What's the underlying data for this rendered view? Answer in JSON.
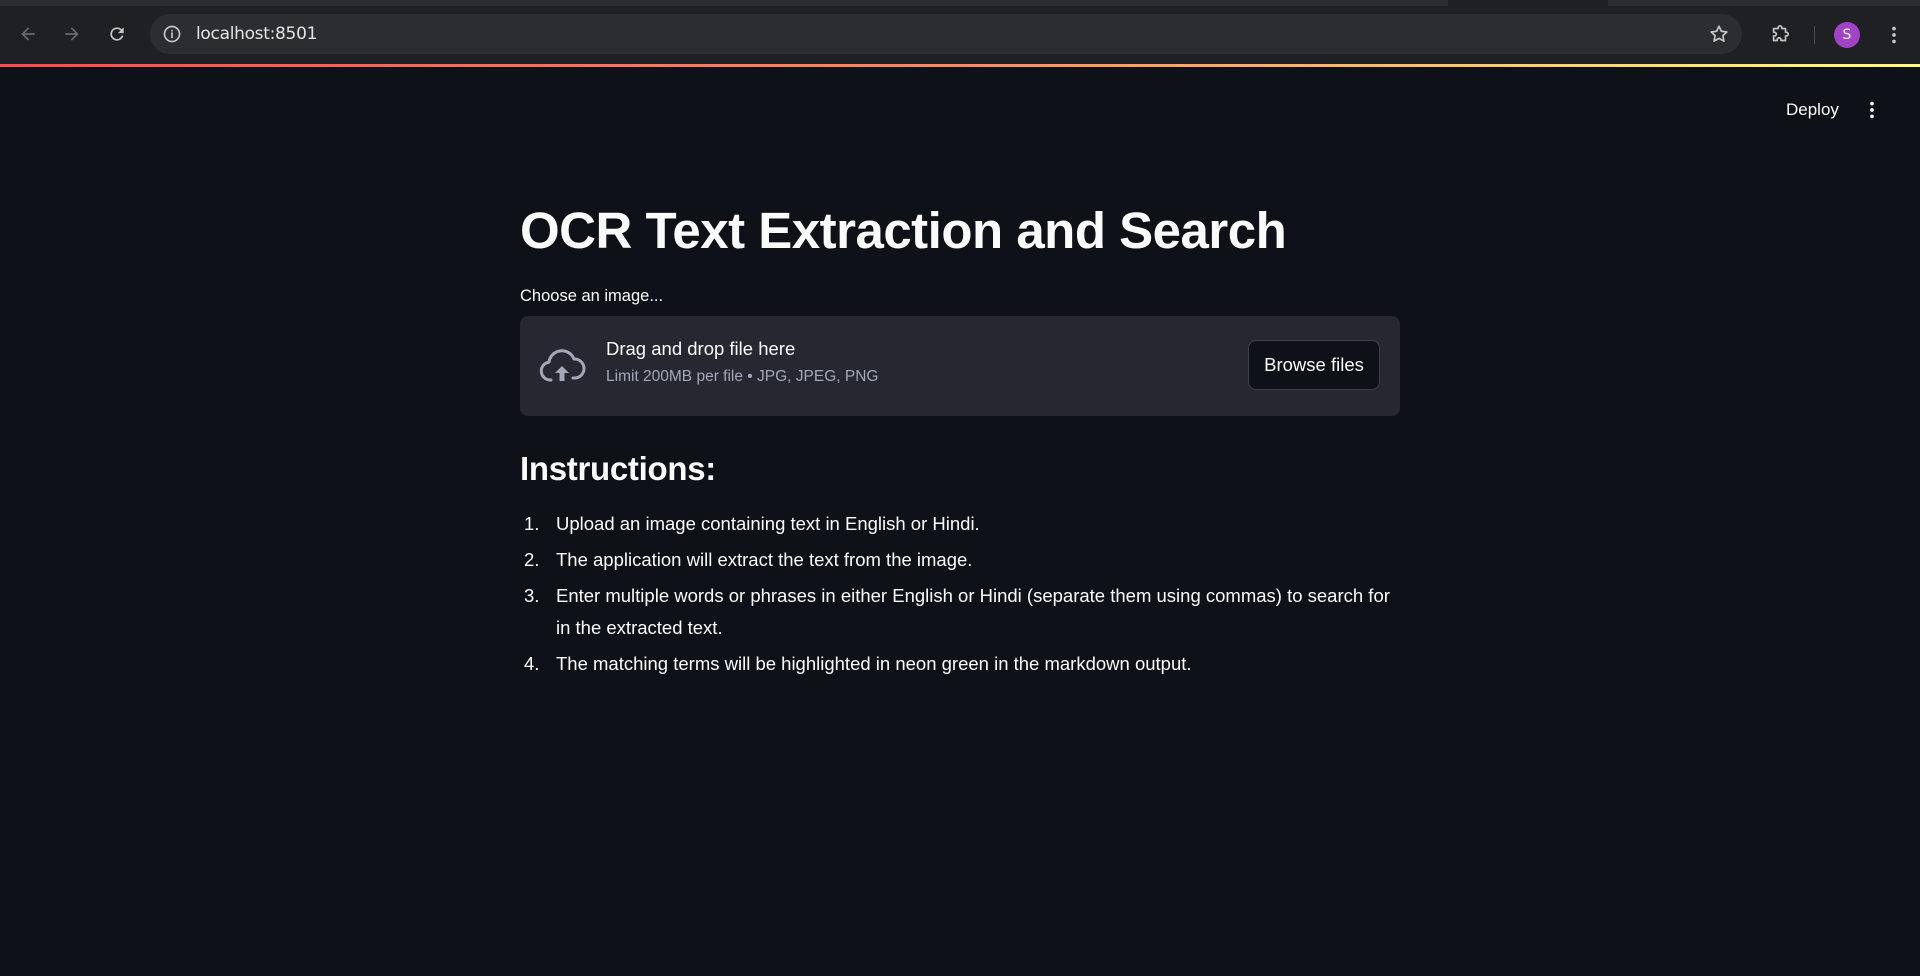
{
  "browser": {
    "url": "localhost:8501",
    "profile_initial": "S",
    "icons": {
      "back": "arrow-left-icon",
      "forward": "arrow-right-icon",
      "reload": "reload-icon",
      "info": "info-icon",
      "bookmark": "star-icon",
      "extensions": "puzzle-icon",
      "menu": "kebab-menu-icon"
    },
    "accent_gradient": [
      "#ff4b4b",
      "#fffd80"
    ]
  },
  "app_header": {
    "deploy_label": "Deploy",
    "menu_icon": "kebab-menu-icon"
  },
  "main": {
    "title": "OCR Text Extraction and Search",
    "uploader": {
      "label": "Choose an image...",
      "drop_text": "Drag and drop file here",
      "limit_text": "Limit 200MB per file • JPG, JPEG, PNG",
      "browse_label": "Browse files",
      "icon": "cloud-upload-icon"
    },
    "instructions_heading": "Instructions:",
    "instructions": [
      {
        "num": "1.",
        "text": "Upload an image containing text in English or Hindi."
      },
      {
        "num": "2.",
        "text": "The application will extract the text from the image."
      },
      {
        "num": "3.",
        "text": "Enter multiple words or phrases in either English or Hindi (separate them using commas) to search for in the extracted text."
      },
      {
        "num": "4.",
        "text": "The matching terms will be highlighted in neon green in the markdown output."
      }
    ]
  },
  "colors": {
    "background": "#0e1117",
    "surface": "#262730",
    "text": "#fafafa",
    "muted_text": "#a3a8b8",
    "avatar": "#a142c7"
  }
}
